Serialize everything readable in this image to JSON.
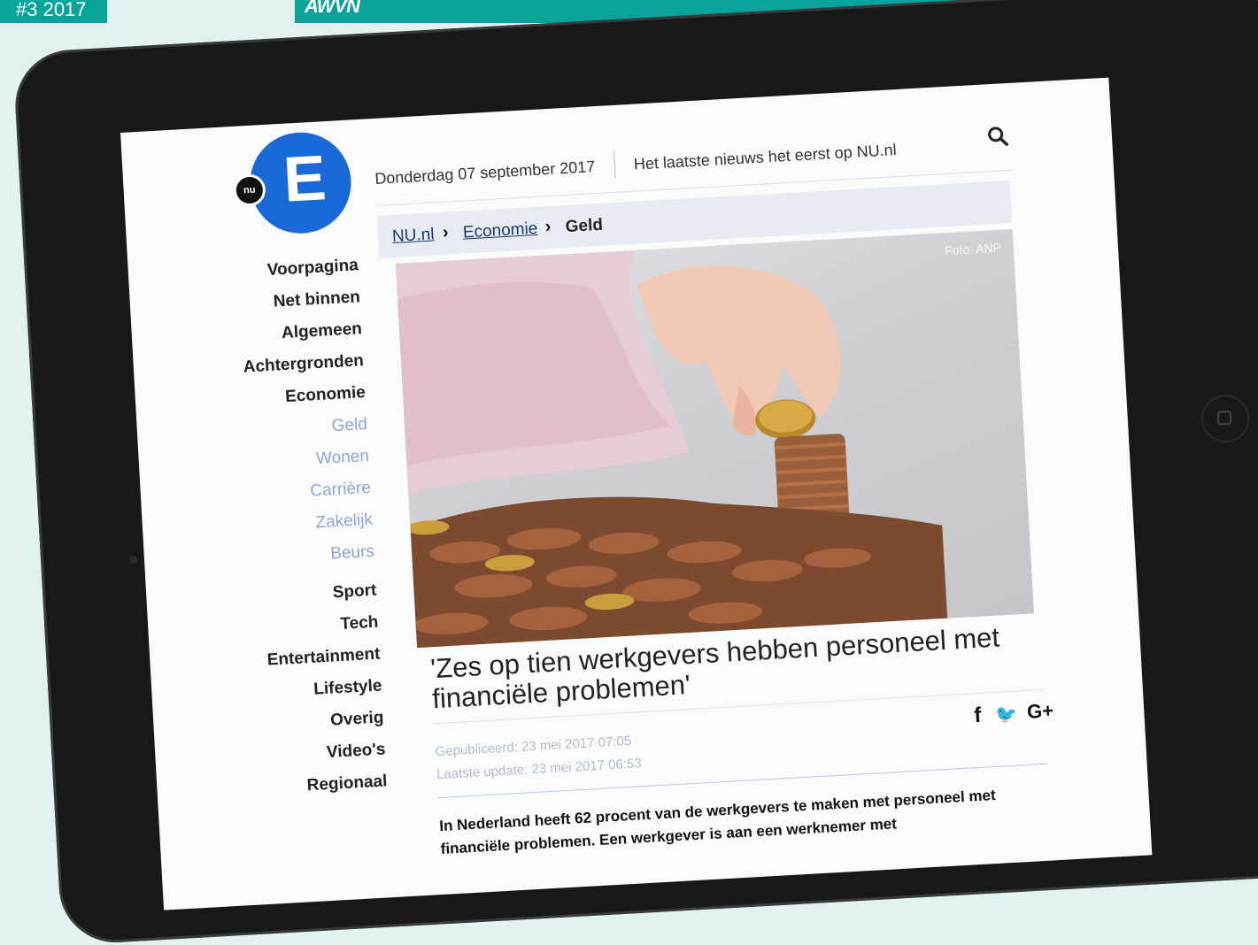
{
  "magazine": {
    "issue": "#3 2017",
    "logo": "AWVN"
  },
  "site": {
    "logo_letter": "E",
    "logo_badge": "nu",
    "date": "Donderdag 07 september 2017",
    "tagline": "Het laatste nieuws het eerst op NU.nl"
  },
  "breadcrumb": {
    "home": "NU.nl",
    "section": "Economie",
    "current": "Geld",
    "separator": "›"
  },
  "nav": {
    "items": [
      "Voorpagina",
      "Net binnen",
      "Algemeen",
      "Achtergronden",
      "Economie"
    ],
    "sub_items": [
      "Geld",
      "Wonen",
      "Carrière",
      "Zakelijk",
      "Beurs"
    ],
    "items2": [
      "Sport",
      "Tech",
      "Entertainment",
      "Lifestyle",
      "Overig",
      "Video's",
      "Regionaal"
    ]
  },
  "article": {
    "photo_credit": "Foto: ANP",
    "headline": "'Zes op tien werkgevers hebben personeel met financiële problemen'",
    "published": "Gepubliceerd: 23 mei 2017 07:05",
    "updated": "Laatste update: 23 mei 2017 06:53",
    "intro": "In Nederland heeft 62 procent van de werkgevers te maken met personeel met financiële problemen. Een werkgever is aan een werknemer met"
  },
  "social": {
    "facebook": "f",
    "twitter": "🐦",
    "googleplus": "G+"
  },
  "colors": {
    "accent": "#08a39a",
    "logo_blue": "#1a69d8",
    "subnav": "#8ca6cf"
  }
}
